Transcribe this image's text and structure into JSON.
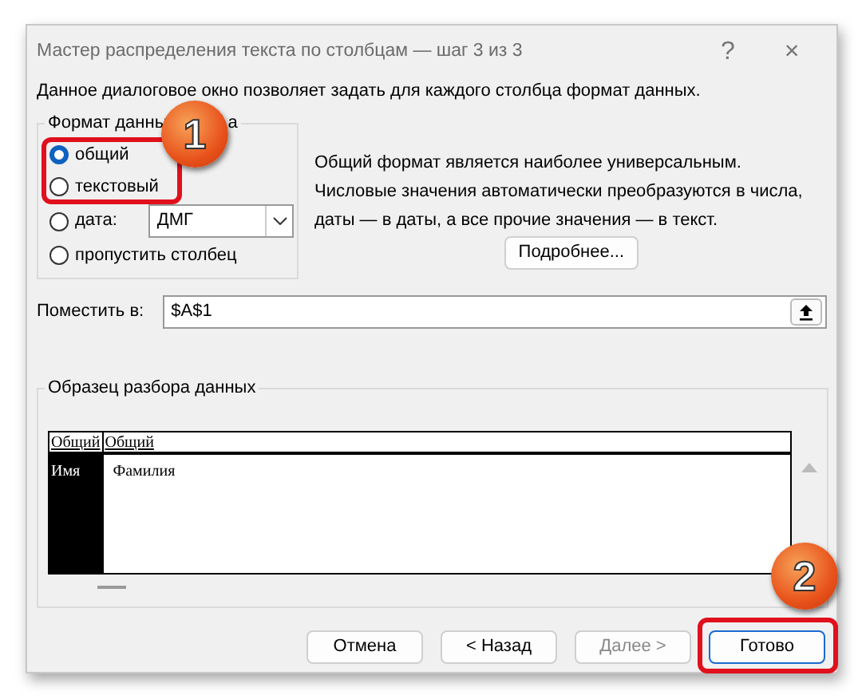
{
  "window": {
    "title": "Мастер распределения текста по столбцам — шаг 3 из 3",
    "help": "?",
    "close": "×"
  },
  "description": "Данное диалоговое окно позволяет задать для каждого столбца формат данных.",
  "format_group": {
    "legend_parts": [
      "Формат данны",
      "а"
    ],
    "options": [
      {
        "kind": "radio",
        "label": "общий",
        "selected": true
      },
      {
        "kind": "radio",
        "label": "текстовый",
        "selected": false
      },
      {
        "kind": "radio-select",
        "label": "дата:",
        "selected": false,
        "value": "ДМГ"
      },
      {
        "kind": "radio",
        "label": "пропустить столбец",
        "selected": false
      }
    ]
  },
  "hint": [
    "Общий формат является наиболее универсальным.",
    "Числовые значения автоматически преобразуются в числа,",
    "даты — в даты, а все прочие значения — в текст."
  ],
  "more_button": "Подробнее...",
  "destination": {
    "label": "Поместить в:",
    "value": "$A$1"
  },
  "preview": {
    "legend": "Образец разбора данных",
    "columns": [
      {
        "header": "Общий",
        "selected": true,
        "cells": [
          "Имя"
        ]
      },
      {
        "header": "Общий",
        "selected": false,
        "cells": [
          "Фамилия"
        ]
      }
    ]
  },
  "buttons": [
    {
      "label": "Отмена",
      "disabled": false,
      "default": false
    },
    {
      "label": "< Назад",
      "disabled": false,
      "default": false
    },
    {
      "label": "Далее >",
      "disabled": true,
      "default": false
    },
    {
      "label": "Готово",
      "disabled": false,
      "default": true
    }
  ],
  "annotations": [
    {
      "number": "1"
    },
    {
      "number": "2"
    }
  ]
}
